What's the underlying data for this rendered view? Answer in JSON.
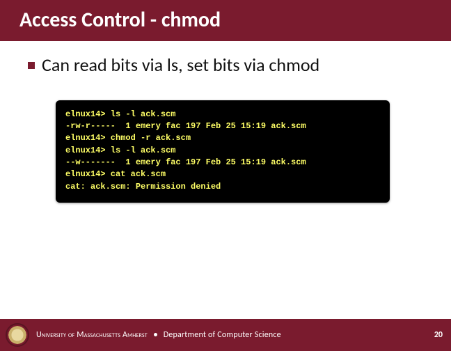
{
  "title": "Access Control - chmod",
  "bullet": "Can read bits via ls, set bits via chmod",
  "terminal": {
    "l0": "elnux14> ls -l ack.scm",
    "l1": "-rw-r-----  1 emery fac 197 Feb 25 15:19 ack.scm",
    "l2": "elnux14> chmod -r ack.scm",
    "l3": "elnux14> ls -l ack.scm",
    "l4": "--w-------  1 emery fac 197 Feb 25 15:19 ack.scm",
    "l5": "elnux14> cat ack.scm",
    "l6": "cat: ack.scm: Permission denied"
  },
  "footer": {
    "university": "University of Massachusetts Amherst",
    "department": "Department of Computer Science",
    "page": "20"
  }
}
